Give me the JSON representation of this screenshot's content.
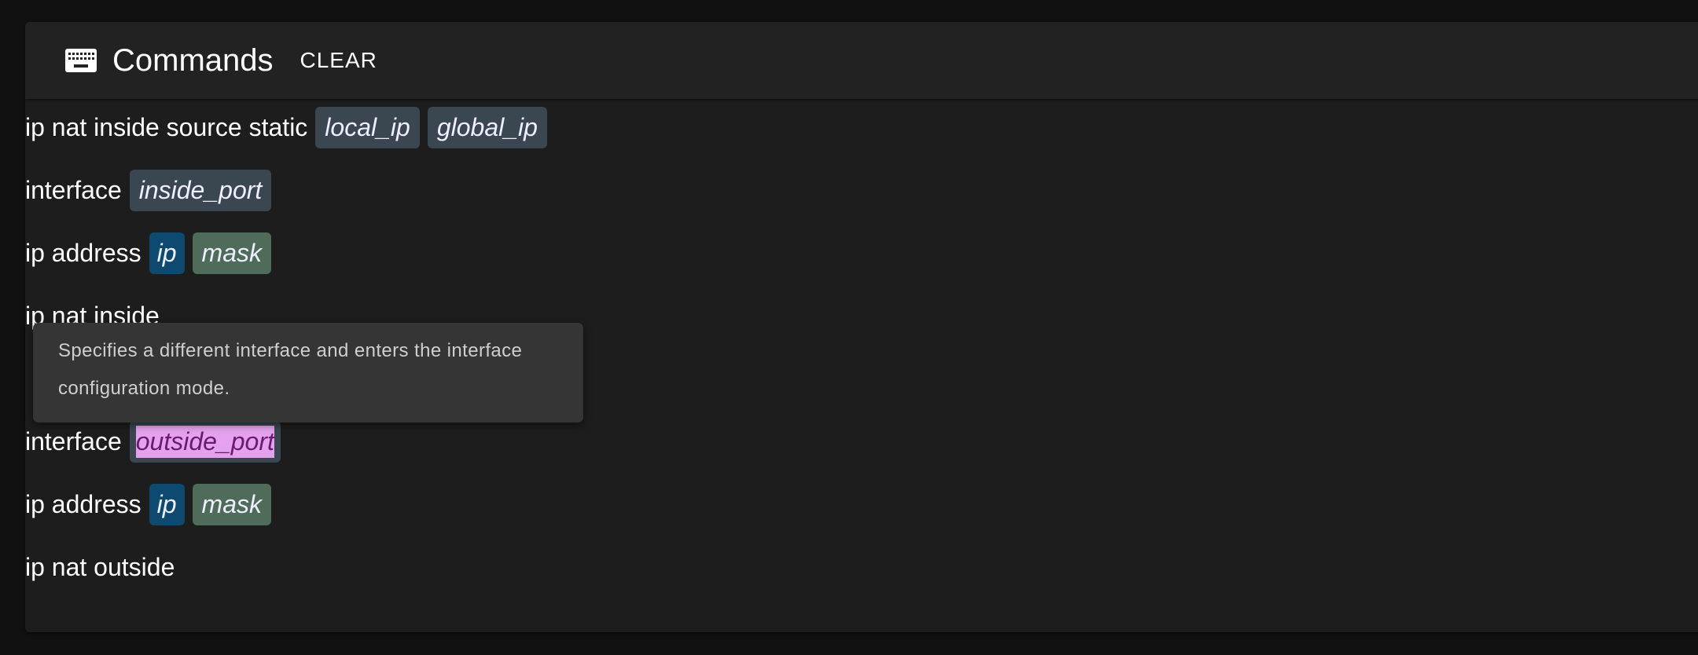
{
  "header": {
    "title": "Commands",
    "clear_label": "CLEAR",
    "icon": "keyboard-icon"
  },
  "rows": [
    {
      "command": "ip nat inside source static",
      "params": [
        {
          "label": "local_ip",
          "kind": "default"
        },
        {
          "label": "global_ip",
          "kind": "default"
        }
      ]
    },
    {
      "command": "interface",
      "params": [
        {
          "label": "inside_port",
          "kind": "default"
        }
      ]
    },
    {
      "command": "ip address",
      "params": [
        {
          "label": "ip",
          "kind": "ip"
        },
        {
          "label": "mask",
          "kind": "mask"
        }
      ]
    },
    {
      "command": "ip nat inside",
      "params": []
    },
    {
      "command": "",
      "params": []
    },
    {
      "command": "interface",
      "params": [
        {
          "label": "outside_port",
          "kind": "selected"
        }
      ]
    },
    {
      "command": "ip address",
      "params": [
        {
          "label": "ip",
          "kind": "ip"
        },
        {
          "label": "mask",
          "kind": "mask"
        }
      ]
    },
    {
      "command": "ip nat outside",
      "params": []
    }
  ],
  "tooltip": {
    "text": "Specifies a different interface and enters the interface configuration mode."
  },
  "colors": {
    "background": "#111111",
    "panel": "#1d1d1d",
    "header": "#222222",
    "chip_default": "#3a4650",
    "chip_ip": "#0e4a6f",
    "chip_mask": "#4f6b5a",
    "selection": "#e4a2ee",
    "tooltip": "#353535"
  }
}
